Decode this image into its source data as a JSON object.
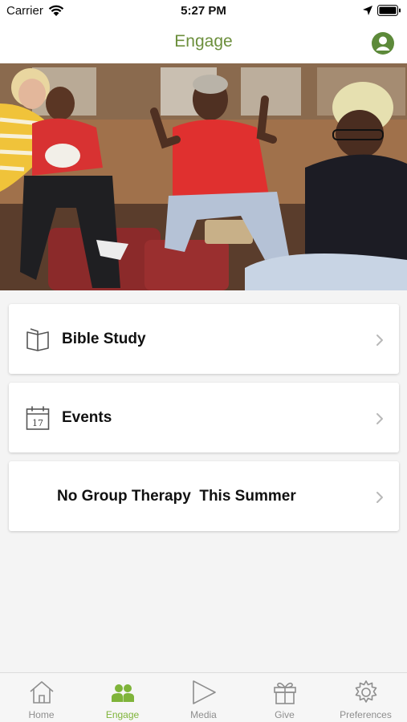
{
  "status_bar": {
    "carrier": "Carrier",
    "time": "5:27 PM"
  },
  "header": {
    "title": "Engage",
    "accent_color": "#6c8f3c"
  },
  "hero": {
    "icon": "photo-of-smiling-women"
  },
  "cards": [
    {
      "label": "Bible Study",
      "icon": "open-book-icon"
    },
    {
      "label": "Events",
      "icon": "calendar-17-icon",
      "calendar_day": "17"
    },
    {
      "label": "No Group Therapy  This Summer",
      "icon": null
    }
  ],
  "tab_bar": {
    "active_color": "#7fb43a",
    "inactive_color": "#8e8e8e",
    "active_tab": "Engage",
    "tabs": [
      {
        "label": "Home",
        "icon": "house-icon"
      },
      {
        "label": "Engage",
        "icon": "group-icon"
      },
      {
        "label": "Media",
        "icon": "play-icon"
      },
      {
        "label": "Give",
        "icon": "gift-icon"
      },
      {
        "label": "Preferences",
        "icon": "gear-icon"
      }
    ]
  }
}
